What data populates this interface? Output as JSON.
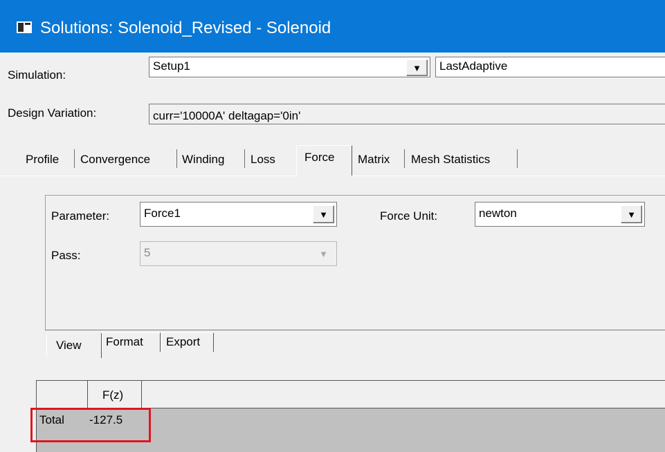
{
  "window": {
    "title": "Solutions: Solenoid_Revised - Solenoid",
    "icon": "window-app-icon",
    "titlebar_color": "#0a78d6"
  },
  "simulation": {
    "label": "Simulation:",
    "setup_value": "Setup1",
    "solution_value": "LastAdaptive"
  },
  "design_variation": {
    "label": "Design Variation:",
    "value": "curr='10000A' deltagap='0in'"
  },
  "tabs": [
    {
      "label": "Profile"
    },
    {
      "label": "Convergence"
    },
    {
      "label": "Winding"
    },
    {
      "label": "Loss"
    },
    {
      "label": "Force",
      "active": true
    },
    {
      "label": "Matrix"
    },
    {
      "label": "Mesh Statistics"
    }
  ],
  "force_panel": {
    "parameter_label": "Parameter:",
    "parameter_value": "Force1",
    "force_unit_label": "Force Unit:",
    "force_unit_value": "newton",
    "pass_label": "Pass:",
    "pass_value": "5"
  },
  "subtabs": [
    {
      "label": "View",
      "active": true
    },
    {
      "label": "Format"
    },
    {
      "label": "Export"
    }
  ],
  "table": {
    "columns": [
      "F(z)"
    ],
    "rows": [
      {
        "label": "Total",
        "values": [
          "-127.5"
        ]
      }
    ],
    "highlight_color": "#e3151c"
  }
}
